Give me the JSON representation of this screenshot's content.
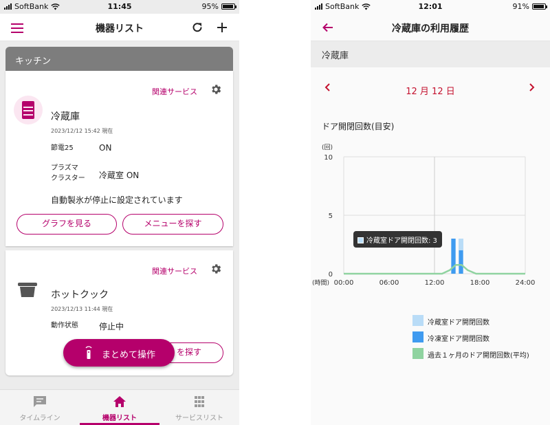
{
  "left": {
    "status": {
      "carrier": "SoftBank",
      "time": "11:45",
      "battery": "95%",
      "battery_level": 0.95
    },
    "nav": {
      "title": "機器リスト",
      "menu_icon": "hamburger-menu-icon",
      "refresh_icon": "refresh-icon",
      "add_icon": "plus-icon"
    },
    "section": {
      "title": "キッチン"
    },
    "devices": [
      {
        "icon": "refrigerator-icon",
        "related": "関連サービス",
        "name": "冷蔵庫",
        "date": "2023/12/12 15:42 現在",
        "props": [
          {
            "label": "節電25",
            "value": "ON"
          },
          {
            "label": "プラズマ\nクラスター",
            "value": "冷蔵室 ON"
          }
        ],
        "notice": "自動製氷が停止に設定されています",
        "buttons": [
          "グラフを見る",
          "メニューを探す"
        ]
      },
      {
        "icon": "cooking-pot-icon",
        "related": "関連サービス",
        "name": "ホットクック",
        "date": "2023/12/13 11:44 現在",
        "props": [
          {
            "label": "動作状態",
            "value": "停止中"
          }
        ],
        "button_partial": "を探す"
      }
    ],
    "fab": {
      "label": "まとめて操作",
      "icon": "remote-control-icon"
    },
    "tabs": [
      {
        "label": "タイムライン",
        "icon": "chat-icon"
      },
      {
        "label": "機器リスト",
        "icon": "home-icon"
      },
      {
        "label": "サービスリスト",
        "icon": "grid-icon"
      }
    ],
    "active_tab": 1,
    "accent": "#b5006b"
  },
  "right": {
    "status": {
      "carrier": "SoftBank",
      "time": "12:01",
      "battery": "91%",
      "battery_level": 0.91
    },
    "nav": {
      "title": "冷蔵庫の利用履歴",
      "back_icon": "back-arrow-icon"
    },
    "subheader": "冷蔵庫",
    "date": "12 月 12 日",
    "chart_title": "ドア開閉回数(目安)",
    "tooltip": "冷蔵室ドア開閉回数: 3",
    "chart_data": {
      "type": "bar",
      "ylabel": "(回)",
      "xlabel": "(時間)",
      "ylim": [
        0,
        10
      ],
      "yticks": [
        "0",
        "5",
        "10"
      ],
      "xlim": [
        0,
        24
      ],
      "xticks": [
        "00:00",
        "06:00",
        "12:00",
        "18:00",
        "24:00"
      ],
      "grid": true,
      "legend_position": "bottom",
      "series": [
        {
          "name": "冷蔵室ドア開閉回数",
          "type": "bar",
          "color": "#b9dcf7",
          "points": [
            {
              "x": 14.5,
              "y": 3
            },
            {
              "x": 15.5,
              "y": 3
            }
          ]
        },
        {
          "name": "冷凍室ドア開閉回数",
          "type": "bar",
          "color": "#3f9bf0",
          "points": [
            {
              "x": 14.5,
              "y": 3
            },
            {
              "x": 15.5,
              "y": 2
            }
          ]
        },
        {
          "name": "過去１ヶ月のドア開閉回数(平均)",
          "type": "line",
          "color": "#8fd3a0",
          "points": [
            {
              "x": 0,
              "y": 0
            },
            {
              "x": 13,
              "y": 0
            },
            {
              "x": 14,
              "y": 0.3
            },
            {
              "x": 14.8,
              "y": 0.75
            },
            {
              "x": 15.6,
              "y": 0.75
            },
            {
              "x": 16.4,
              "y": 0.3
            },
            {
              "x": 17.5,
              "y": 0
            },
            {
              "x": 24,
              "y": 0
            }
          ]
        }
      ]
    }
  }
}
